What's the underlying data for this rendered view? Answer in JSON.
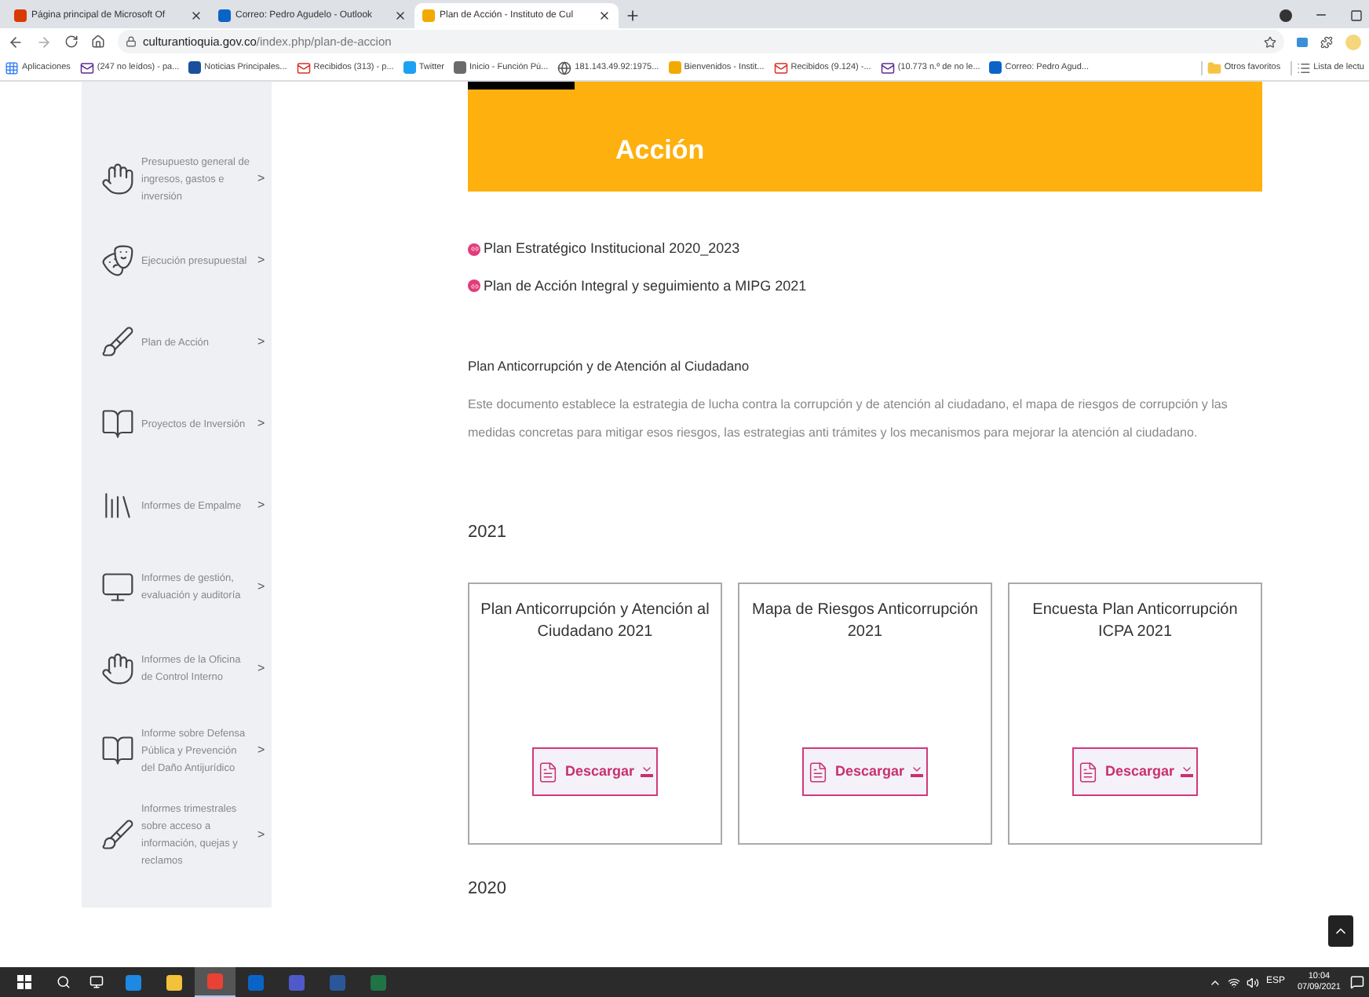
{
  "browser": {
    "tabs": [
      {
        "title": "Página principal de Microsoft Of",
        "selected": false
      },
      {
        "title": "Correo: Pedro Agudelo - Outlook",
        "selected": false
      },
      {
        "title": "Plan de Acción - Instituto de Cul",
        "selected": true
      }
    ],
    "address": {
      "host": "culturantioquia.gov.co",
      "path": "/index.php/plan-de-accion"
    },
    "bookmarks": [
      "Aplicaciones",
      "(247 no leídos) - pa...",
      "Noticias Principales...",
      "Recibidos (313) - p...",
      "Twitter",
      "Inicio - Función Pú...",
      "181.143.49.92:1975...",
      "Bienvenidos - Instit...",
      "Recibidos (9.124) -...",
      "(10.773 n.º de no le...",
      "Correo: Pedro Agud..."
    ],
    "bookmarks_right": [
      "Otros favoritos",
      "Lista de lectu"
    ]
  },
  "sidebar": {
    "items": [
      {
        "label": "Presupuesto general de ingresos, gastos e inversión",
        "arrow": ">"
      },
      {
        "label": "Ejecución presupuestal",
        "arrow": ">"
      },
      {
        "label": "Plan de Acción",
        "arrow": ">"
      },
      {
        "label": "Proyectos de Inversión",
        "arrow": ">"
      },
      {
        "label": "Informes de Empalme",
        "arrow": ">"
      },
      {
        "label": "Informes de gestión, evaluación y auditoría",
        "arrow": ">"
      },
      {
        "label": "Informes de la Oficina de Control Interno",
        "arrow": ">"
      },
      {
        "label": "Informe sobre Defensa Pública y Prevención del Daño Antijurídico",
        "arrow": ">"
      },
      {
        "label": "Informes trimestrales sobre acceso a información, quejas y reclamos",
        "arrow": ">"
      }
    ]
  },
  "banner": {
    "title": "Acción"
  },
  "links": [
    "Plan Estratégico Institucional 2020_2023",
    "Plan de Acción Integral y seguimiento a MIPG 2021"
  ],
  "section": {
    "heading": "Plan Anticorrupción y de Atención al Ciudadano",
    "text": "Este documento establece la estrategia de lucha contra la corrupción y de atención al ciudadano, el mapa de riesgos de corrupción y las medidas concretas para mitigar esos riesgos, las estrategias anti trámites y los mecanismos para mejorar la atención al ciudadano."
  },
  "year_2021": "2021",
  "cards": [
    {
      "title": "Plan Anticorrupción y Atención al Ciudadano 2021",
      "button": "Descargar"
    },
    {
      "title": "Mapa de Riesgos Anticorrupción 2021",
      "button": "Descargar"
    },
    {
      "title": "Encuesta Plan Anticorrupción ICPA 2021",
      "button": "Descargar"
    }
  ],
  "year_2020": "2020",
  "taskbar": {
    "apps": [
      {
        "kind": "edge",
        "active": false
      },
      {
        "kind": "files",
        "active": false
      },
      {
        "kind": "chrome",
        "active": true
      },
      {
        "kind": "outlook",
        "active": false
      },
      {
        "kind": "teams",
        "active": false
      },
      {
        "kind": "word",
        "active": false
      },
      {
        "kind": "excel",
        "active": false
      }
    ],
    "language": "ESP",
    "time": "10:04",
    "date": "07/09/2021"
  }
}
